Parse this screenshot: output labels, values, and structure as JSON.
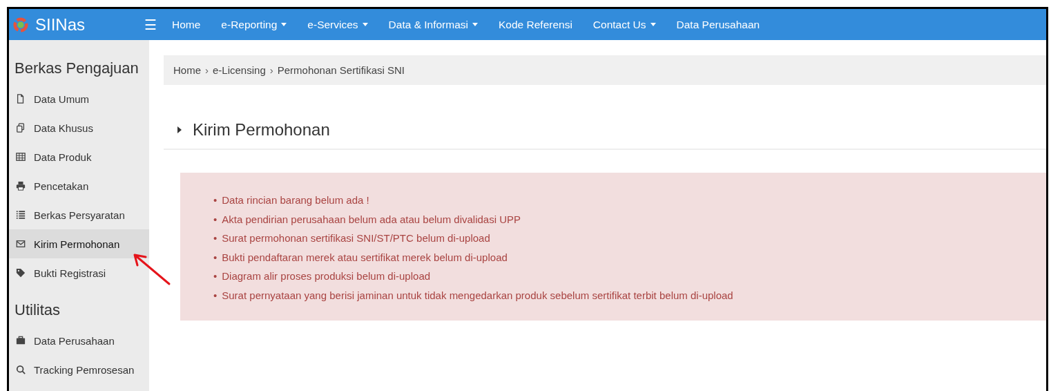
{
  "navbar": {
    "brand": "SIINas",
    "menu": "☰",
    "items": [
      {
        "label": "Home",
        "has_dropdown": false
      },
      {
        "label": "e-Reporting",
        "has_dropdown": true
      },
      {
        "label": "e-Services",
        "has_dropdown": true
      },
      {
        "label": "Data & Informasi",
        "has_dropdown": true
      },
      {
        "label": "Kode Referensi",
        "has_dropdown": false
      },
      {
        "label": "Contact Us",
        "has_dropdown": true
      },
      {
        "label": "Data Perusahaan",
        "has_dropdown": false
      }
    ]
  },
  "sidebar": {
    "sections": [
      {
        "heading": "Berkas Pengajuan",
        "items": [
          {
            "label": "Data Umum",
            "selected": false
          },
          {
            "label": "Data Khusus",
            "selected": false
          },
          {
            "label": "Data Produk",
            "selected": false
          },
          {
            "label": "Pencetakan",
            "selected": false
          },
          {
            "label": "Berkas Persyaratan",
            "selected": false
          },
          {
            "label": "Kirim Permohonan",
            "selected": true
          },
          {
            "label": "Bukti Registrasi",
            "selected": false
          }
        ]
      },
      {
        "heading": "Utilitas",
        "items": [
          {
            "label": "Data Perusahaan",
            "selected": false
          },
          {
            "label": "Tracking Pemrosesan",
            "selected": false
          }
        ]
      }
    ]
  },
  "breadcrumb": {
    "separator": "›",
    "items": [
      "Home",
      "e-Licensing",
      "Permohonan Sertifikasi SNI"
    ]
  },
  "page_title": "Kirim Permohonan",
  "alert": {
    "bullet": "•",
    "items": [
      "Data rincian barang belum ada !",
      "Akta pendirian perusahaan belum ada atau belum divalidasi UPP",
      "Surat permohonan sertifikasi SNI/ST/PTC belum di-upload",
      "Bukti pendaftaran merek atau sertifikat merek belum di-upload",
      "Diagram alir proses produksi belum di-upload",
      "Surat pernyataan yang berisi jaminan untuk tidak mengedarkan produk sebelum sertifikat terbit belum di-upload"
    ]
  }
}
